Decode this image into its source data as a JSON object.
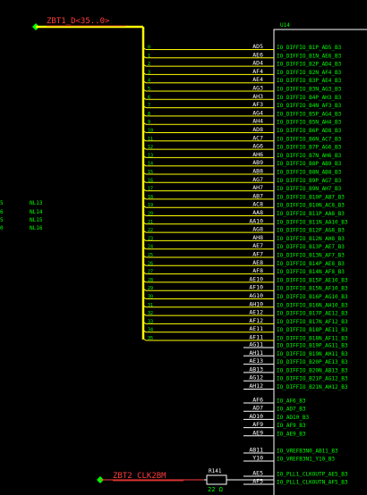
{
  "bus_top": {
    "label": "ZBT1_D<35..0>",
    "color": "#ff3b3b"
  },
  "bus_bottom": {
    "label": "ZBT2_CLK2BM",
    "color": "#ff3b3b"
  },
  "component": {
    "ref": "U14"
  },
  "resistor": {
    "ref": "R141",
    "value": "22 Ω"
  },
  "colors": {
    "wire": "#ffff00",
    "green": "#00ff00",
    "white": "#ffffff",
    "junction": "#00ff00"
  },
  "net_labels_left": [
    "NL13",
    "NL14",
    "NL15",
    "NL16"
  ],
  "left_partial": [
    "5",
    "6",
    "5",
    "0"
  ],
  "bus_rows": [
    {
      "num": "0",
      "pin": "AD5",
      "func": "IO_DIFFIO_B1P_AD5_B3"
    },
    {
      "num": "1",
      "pin": "AE6",
      "func": "IO_DIFFIO_B1N_AE6_B3"
    },
    {
      "num": "2",
      "pin": "AD4",
      "func": "IO_DIFFIO_B2P_AD4_B3"
    },
    {
      "num": "3",
      "pin": "AF4",
      "func": "IO_DIFFIO_B2N_AF4_B3"
    },
    {
      "num": "4",
      "pin": "AE4",
      "func": "IO_DIFFIO_B3P_AE4_B3"
    },
    {
      "num": "5",
      "pin": "AG3",
      "func": "IO_DIFFIO_B3N_AG3_B3"
    },
    {
      "num": "6",
      "pin": "AH3",
      "func": "IO_DIFFIO_B4P_AH3_B3"
    },
    {
      "num": "7",
      "pin": "AF3",
      "func": "IO_DIFFIO_B4N_AF3_B3"
    },
    {
      "num": "8",
      "pin": "AG4",
      "func": "IO_DIFFIO_B5P_AG4_B3"
    },
    {
      "num": "9",
      "pin": "AH4",
      "func": "IO_DIFFIO_B5N_AH4_B3"
    },
    {
      "num": "10",
      "pin": "AD8",
      "func": "IO_DIFFIO_B6P_AD8_B3"
    },
    {
      "num": "11",
      "pin": "AC7",
      "func": "IO_DIFFIO_B6N_AC7_B3"
    },
    {
      "num": "12",
      "pin": "AG6",
      "func": "IO_DIFFIO_B7P_AG6_B3"
    },
    {
      "num": "13",
      "pin": "AH6",
      "func": "IO_DIFFIO_B7N_AH6_B3"
    },
    {
      "num": "14",
      "pin": "AB9",
      "func": "IO_DIFFIO_B8P_AB9_B3"
    },
    {
      "num": "15",
      "pin": "AB8",
      "func": "IO_DIFFIO_B8N_AB8_B3"
    },
    {
      "num": "16",
      "pin": "AG7",
      "func": "IO_DIFFIO_B9P_AG7_B3"
    },
    {
      "num": "17",
      "pin": "AH7",
      "func": "IO_DIFFIO_B9N_AH7_B3"
    },
    {
      "num": "18",
      "pin": "AB7",
      "func": "IO_DIFFIO_B10P_AB7_B3"
    },
    {
      "num": "19",
      "pin": "AC8",
      "func": "IO_DIFFIO_B10N_AC8_B3"
    },
    {
      "num": "20",
      "pin": "AA8",
      "func": "IO_DIFFIO_B11P_AA8_B3"
    },
    {
      "num": "21",
      "pin": "AA10",
      "func": "IO_DIFFIO_B11N_AA10_B3"
    },
    {
      "num": "22",
      "pin": "AG8",
      "func": "IO_DIFFIO_B12P_AG8_B3"
    },
    {
      "num": "23",
      "pin": "AH8",
      "func": "IO_DIFFIO_B12N_AH8_B3"
    },
    {
      "num": "24",
      "pin": "AE7",
      "func": "IO_DIFFIO_B13P_AE7_B3"
    },
    {
      "num": "25",
      "pin": "AF7",
      "func": "IO_DIFFIO_B13N_AF7_B3"
    },
    {
      "num": "26",
      "pin": "AE8",
      "func": "IO_DIFFIO_B14P_AE8_B3"
    },
    {
      "num": "27",
      "pin": "AF8",
      "func": "IO_DIFFIO_B14N_AF8_B3"
    },
    {
      "num": "28",
      "pin": "AE10",
      "func": "IO_DIFFIO_B15P_AE10_B3"
    },
    {
      "num": "29",
      "pin": "AF10",
      "func": "IO_DIFFIO_B15N_AF10_B3"
    },
    {
      "num": "30",
      "pin": "AG10",
      "func": "IO_DIFFIO_B16P_AG10_B3"
    },
    {
      "num": "31",
      "pin": "AH10",
      "func": "IO_DIFFIO_B16N_AH10_B3"
    },
    {
      "num": "32",
      "pin": "AE12",
      "func": "IO_DIFFIO_B17P_AE12_B3"
    },
    {
      "num": "33",
      "pin": "AF12",
      "func": "IO_DIFFIO_B17N_AF12_B3"
    },
    {
      "num": "34",
      "pin": "AE11",
      "func": "IO_DIFFIO_B18P_AE11_B3"
    },
    {
      "num": "35",
      "pin": "AF11",
      "func": "IO_DIFFIO_B18N_AF11_B3"
    }
  ],
  "free_rows": [
    {
      "pin": "AG11",
      "func": "IO_DIFFIO_B19P_AG11_B3"
    },
    {
      "pin": "AH11",
      "func": "IO_DIFFIO_B19N_AH11_B3"
    },
    {
      "pin": "AE13",
      "func": "IO_DIFFIO_B20P_AE13_B3"
    },
    {
      "pin": "AB13",
      "func": "IO_DIFFIO_B20N_AB13_B3"
    },
    {
      "pin": "AG12",
      "func": "IO_DIFFIO_B21P_AG12_B3"
    },
    {
      "pin": "AH12",
      "func": "IO_DIFFIO_B21N_AH12_B3"
    }
  ],
  "single_rows": [
    {
      "pin": "AF6",
      "func": "IO_AF6_B3"
    },
    {
      "pin": "AD7",
      "func": "IO_AD7_B3"
    },
    {
      "pin": "AD10",
      "func": "IO_AD10_B3"
    },
    {
      "pin": "AF9",
      "func": "IO_AF9_B3"
    },
    {
      "pin": "AE9",
      "func": "IO_AE9_B3"
    }
  ],
  "vref_rows": [
    {
      "pin": "AB11",
      "func": "IO_VREFB3N0_AB11_B3"
    },
    {
      "pin": "Y10",
      "func": "IO_VREFB3N1_Y10_B3"
    }
  ],
  "pll_rows": [
    {
      "pin": "AE5",
      "func": "IO_PLL1_CLKOUTP_AE5_B3"
    },
    {
      "pin": "AF5",
      "func": "IO_PLL1_CLKOUTN_AF5_B3"
    }
  ]
}
